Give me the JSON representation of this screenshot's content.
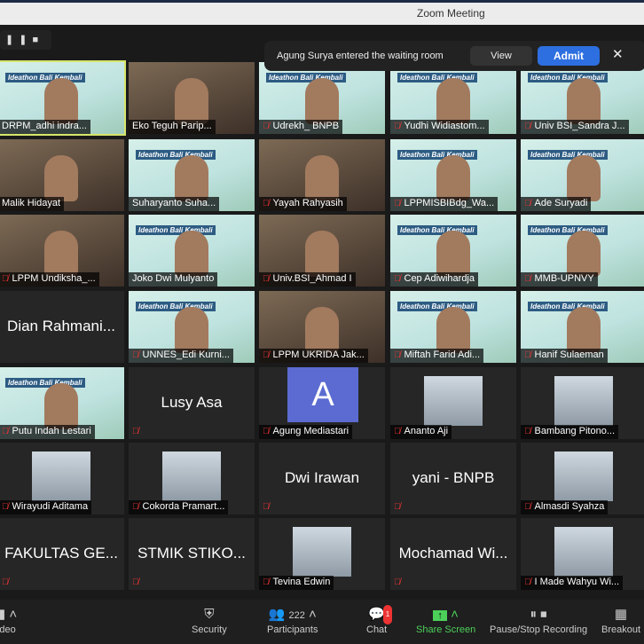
{
  "window": {
    "title": "Zoom Meeting"
  },
  "recording_controls": {
    "pause": "❚❚",
    "stop": "■"
  },
  "notification": {
    "message": "Agung Surya entered the waiting room",
    "view": "View",
    "admit": "Admit",
    "close": "✕"
  },
  "tiles": [
    {
      "name": "DRPM_adhi indra...",
      "kind": "video",
      "muted": false,
      "active": true
    },
    {
      "name": "Eko Teguh Parip...",
      "kind": "room",
      "muted": false
    },
    {
      "name": "Udrekh_ BNPB",
      "kind": "video",
      "muted": true
    },
    {
      "name": "Yudhi Widiastom...",
      "kind": "video",
      "muted": true
    },
    {
      "name": "Univ BSI_Sandra J...",
      "kind": "video",
      "muted": true
    },
    {
      "name": "Malik Hidayat",
      "kind": "room",
      "muted": false
    },
    {
      "name": "Suharyanto Suha...",
      "kind": "video",
      "muted": false
    },
    {
      "name": "Yayah Rahyasih",
      "kind": "room",
      "muted": true
    },
    {
      "name": "LPPMISBIBdg_Wa...",
      "kind": "video",
      "muted": true
    },
    {
      "name": "Ade Suryadi",
      "kind": "video",
      "muted": true
    },
    {
      "name": "LPPM Undiksha_...",
      "kind": "room",
      "muted": true
    },
    {
      "name": "Joko Dwi Mulyanto",
      "kind": "video",
      "muted": false
    },
    {
      "name": "Univ.BSI_Ahmad I",
      "kind": "room",
      "muted": true
    },
    {
      "name": "Cep Adiwihardja",
      "kind": "video",
      "muted": true
    },
    {
      "name": "MMB-UPNVY",
      "kind": "video",
      "muted": true
    },
    {
      "name": "Dian Rahmani...",
      "kind": "name",
      "muted": false
    },
    {
      "name": "UNNES_Edi Kurni...",
      "kind": "video",
      "muted": true
    },
    {
      "name": "LPPM UKRIDA Jak...",
      "kind": "room",
      "muted": true
    },
    {
      "name": "Miftah Farid Adi...",
      "kind": "video",
      "muted": true
    },
    {
      "name": "Hanif Sulaeman",
      "kind": "video",
      "muted": true
    },
    {
      "name": "Putu Indah Lestari",
      "kind": "video",
      "muted": true
    },
    {
      "name": "Lusy Asa",
      "kind": "name",
      "muted": true
    },
    {
      "name": "Agung Mediastari",
      "kind": "avatar",
      "initial": "A",
      "muted": true
    },
    {
      "name": "Ananto Aji",
      "kind": "photo",
      "muted": true
    },
    {
      "name": "Bambang Pitono...",
      "kind": "photo",
      "muted": true
    },
    {
      "name": "Wirayudi Aditama",
      "kind": "photo",
      "muted": true
    },
    {
      "name": "Cokorda Pramart...",
      "kind": "photo",
      "muted": true
    },
    {
      "name": "Dwi Irawan",
      "kind": "name",
      "muted": true
    },
    {
      "name": "yani - BNPB",
      "kind": "name",
      "muted": true
    },
    {
      "name": "Almasdi Syahza",
      "kind": "photo",
      "muted": true
    },
    {
      "name": "FAKULTAS GE...",
      "kind": "name",
      "muted": true
    },
    {
      "name": "STMIK STIKO...",
      "kind": "name",
      "muted": true
    },
    {
      "name": "Tevina Edwin",
      "kind": "photo",
      "muted": true
    },
    {
      "name": "Mochamad Wi...",
      "kind": "name",
      "muted": true
    },
    {
      "name": "I Made Wahyu Wi...",
      "kind": "photo",
      "muted": true
    }
  ],
  "banner_text": "Ideathon Bali Kembali",
  "toolbar": {
    "video": "deo",
    "security": "Security",
    "participants": "Participants",
    "participant_count": "222",
    "chat": "Chat",
    "chat_badge": "1",
    "share": "Share Screen",
    "recording": "Pause/Stop Recording",
    "breakout": "Breakout"
  },
  "colors": {
    "admit": "#2d6fe0",
    "share": "#4cd05a",
    "active_speaker": "#d7e56b",
    "muted": "#e33333"
  }
}
